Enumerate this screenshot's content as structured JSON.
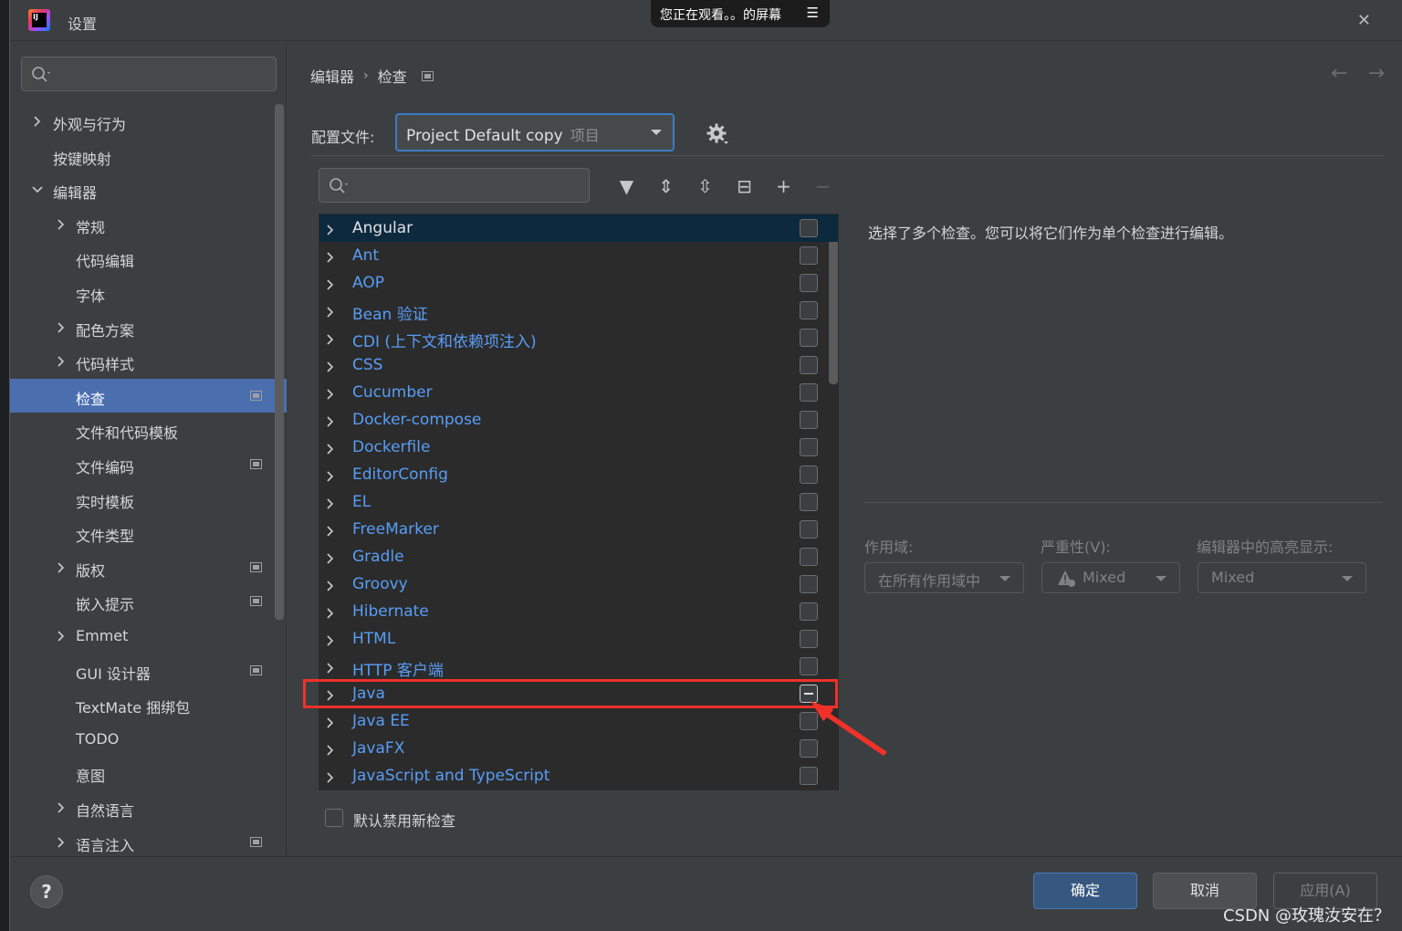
{
  "window": {
    "title": "设置",
    "close_glyph": "✕"
  },
  "share_banner": {
    "text": "您正在观看。。的屏幕",
    "menu_glyph": "☰"
  },
  "sidebar": {
    "search_placeholder": "",
    "items": [
      {
        "label": "外观与行为",
        "expandable": true,
        "expanded": false,
        "indent": 0,
        "page_icon": false,
        "selected": false
      },
      {
        "label": "按键映射",
        "expandable": false,
        "expanded": false,
        "indent": 0,
        "page_icon": false,
        "selected": false
      },
      {
        "label": "编辑器",
        "expandable": true,
        "expanded": true,
        "indent": 0,
        "page_icon": false,
        "selected": false
      },
      {
        "label": "常规",
        "expandable": true,
        "expanded": false,
        "indent": 1,
        "page_icon": false,
        "selected": false
      },
      {
        "label": "代码编辑",
        "expandable": false,
        "expanded": false,
        "indent": 1,
        "page_icon": false,
        "selected": false
      },
      {
        "label": "字体",
        "expandable": false,
        "expanded": false,
        "indent": 1,
        "page_icon": false,
        "selected": false
      },
      {
        "label": "配色方案",
        "expandable": true,
        "expanded": false,
        "indent": 1,
        "page_icon": false,
        "selected": false
      },
      {
        "label": "代码样式",
        "expandable": true,
        "expanded": false,
        "indent": 1,
        "page_icon": false,
        "selected": false
      },
      {
        "label": "检查",
        "expandable": false,
        "expanded": false,
        "indent": 1,
        "page_icon": true,
        "selected": true
      },
      {
        "label": "文件和代码模板",
        "expandable": false,
        "expanded": false,
        "indent": 1,
        "page_icon": false,
        "selected": false
      },
      {
        "label": "文件编码",
        "expandable": false,
        "expanded": false,
        "indent": 1,
        "page_icon": true,
        "selected": false
      },
      {
        "label": "实时模板",
        "expandable": false,
        "expanded": false,
        "indent": 1,
        "page_icon": false,
        "selected": false
      },
      {
        "label": "文件类型",
        "expandable": false,
        "expanded": false,
        "indent": 1,
        "page_icon": false,
        "selected": false
      },
      {
        "label": "版权",
        "expandable": true,
        "expanded": false,
        "indent": 1,
        "page_icon": true,
        "selected": false
      },
      {
        "label": "嵌入提示",
        "expandable": false,
        "expanded": false,
        "indent": 1,
        "page_icon": true,
        "selected": false
      },
      {
        "label": "Emmet",
        "expandable": true,
        "expanded": false,
        "indent": 1,
        "page_icon": false,
        "selected": false
      },
      {
        "label": "GUI 设计器",
        "expandable": false,
        "expanded": false,
        "indent": 1,
        "page_icon": true,
        "selected": false
      },
      {
        "label": "TextMate 捆绑包",
        "expandable": false,
        "expanded": false,
        "indent": 1,
        "page_icon": false,
        "selected": false
      },
      {
        "label": "TODO",
        "expandable": false,
        "expanded": false,
        "indent": 1,
        "page_icon": false,
        "selected": false
      },
      {
        "label": "意图",
        "expandable": false,
        "expanded": false,
        "indent": 1,
        "page_icon": false,
        "selected": false
      },
      {
        "label": "自然语言",
        "expandable": true,
        "expanded": false,
        "indent": 1,
        "page_icon": false,
        "selected": false
      },
      {
        "label": "语言注入",
        "expandable": true,
        "expanded": false,
        "indent": 1,
        "page_icon": true,
        "selected": false
      }
    ]
  },
  "breadcrumb": {
    "parent": "编辑器",
    "separator": "›",
    "current": "检查"
  },
  "nav": {
    "back": "←",
    "forward": "→"
  },
  "profile": {
    "label": "配置文件:",
    "value": "Project Default copy",
    "scope_tag": "项目"
  },
  "filter": {
    "placeholder": "",
    "toolbar": [
      {
        "name": "filter-icon",
        "glyph": "▼",
        "disabled": false
      },
      {
        "name": "expand-all-icon",
        "glyph": "⇕",
        "disabled": false
      },
      {
        "name": "collapse-all-icon",
        "glyph": "⇳",
        "disabled": false
      },
      {
        "name": "reset-icon",
        "glyph": "⊟",
        "disabled": false
      },
      {
        "name": "add-icon",
        "glyph": "+",
        "disabled": false
      },
      {
        "name": "remove-icon",
        "glyph": "−",
        "disabled": true
      }
    ]
  },
  "inspections": [
    {
      "label": "Angular",
      "state": "unchecked",
      "selected": true
    },
    {
      "label": "Ant",
      "state": "unchecked",
      "selected": false
    },
    {
      "label": "AOP",
      "state": "unchecked",
      "selected": false
    },
    {
      "label": "Bean 验证",
      "state": "unchecked",
      "selected": false
    },
    {
      "label": "CDI (上下文和依赖项注入)",
      "state": "unchecked",
      "selected": false
    },
    {
      "label": "CSS",
      "state": "unchecked",
      "selected": false
    },
    {
      "label": "Cucumber",
      "state": "unchecked",
      "selected": false
    },
    {
      "label": "Docker-compose",
      "state": "unchecked",
      "selected": false
    },
    {
      "label": "Dockerfile",
      "state": "unchecked",
      "selected": false
    },
    {
      "label": "EditorConfig",
      "state": "unchecked",
      "selected": false
    },
    {
      "label": "EL",
      "state": "unchecked",
      "selected": false
    },
    {
      "label": "FreeMarker",
      "state": "unchecked",
      "selected": false
    },
    {
      "label": "Gradle",
      "state": "unchecked",
      "selected": false
    },
    {
      "label": "Groovy",
      "state": "unchecked",
      "selected": false
    },
    {
      "label": "Hibernate",
      "state": "unchecked",
      "selected": false
    },
    {
      "label": "HTML",
      "state": "unchecked",
      "selected": false
    },
    {
      "label": "HTTP 客户端",
      "state": "unchecked",
      "selected": false
    },
    {
      "label": "Java",
      "state": "mixed",
      "selected": false
    },
    {
      "label": "Java EE",
      "state": "unchecked",
      "selected": false
    },
    {
      "label": "JavaFX",
      "state": "unchecked",
      "selected": false
    },
    {
      "label": "JavaScript and TypeScript",
      "state": "unchecked",
      "selected": false
    }
  ],
  "default_disable": {
    "label": "默认禁用新检查",
    "checked": false
  },
  "description": "选择了多个检查。您可以将它们作为单个检查进行编辑。",
  "options": {
    "scope": {
      "label": "作用域:",
      "value": "在所有作用域中"
    },
    "severity": {
      "label": "严重性(V):",
      "value": "Mixed"
    },
    "highlight": {
      "label": "编辑器中的高亮显示:",
      "value": "Mixed"
    }
  },
  "footer": {
    "help": "?",
    "ok": "确定",
    "cancel": "取消",
    "apply": "应用(A)"
  },
  "watermark": "CSDN @玫瑰汝安在？",
  "colors": {
    "accent": "#4b6eaf",
    "link_blue": "#589df6",
    "annotation_red": "#f0312a",
    "primary_button": "#365880"
  }
}
